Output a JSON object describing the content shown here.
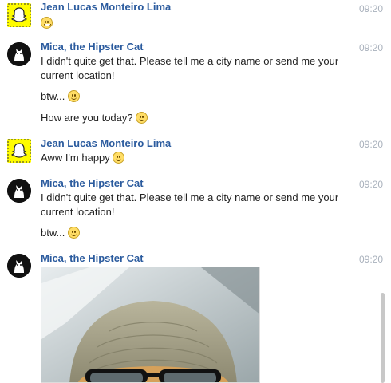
{
  "messages": [
    {
      "sender": "Jean Lucas Monteiro Lima",
      "time": "09:20",
      "text": ""
    },
    {
      "sender": "Mica, the Hipster Cat",
      "time": "09:20",
      "text": "I didn't quite get that. Please tell me a city name or send me your current location!"
    },
    {
      "text": "btw..."
    },
    {
      "text": "How are you today?"
    },
    {
      "sender": "Jean Lucas Monteiro Lima",
      "time": "09:20",
      "text": "Aww I'm happy"
    },
    {
      "sender": "Mica, the Hipster Cat",
      "time": "09:20",
      "text": "I didn't quite get that. Please tell me a city name or send me your current location!"
    },
    {
      "text": "btw..."
    },
    {
      "sender": "Mica, the Hipster Cat",
      "time": "09:20",
      "text": ""
    }
  ],
  "icons": {
    "user_avatar": "snapchat-ghost-icon",
    "bot_avatar": "hipster-cat-icon",
    "emoji_grin": "grinning-face-icon",
    "emoji_smile": "smiling-face-icon"
  },
  "colors": {
    "sender_name": "#2b5b9e",
    "timestamp": "#a9b1bc",
    "user_avatar_bg": "#fffc00",
    "bot_avatar_bg": "#111111"
  }
}
